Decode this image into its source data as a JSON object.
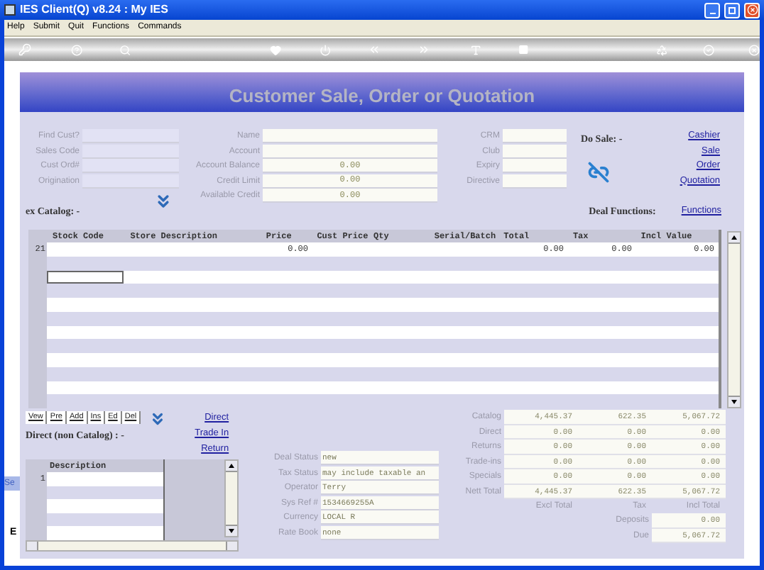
{
  "window": {
    "title": "IES Client(Q) v8.24 : My IES"
  },
  "menu": [
    {
      "label": "Help"
    },
    {
      "label": "Submit"
    },
    {
      "label": "Quit"
    },
    {
      "label": "Functions"
    },
    {
      "label": "Commands"
    }
  ],
  "header": {
    "title": "Customer Sale, Order or Quotation"
  },
  "customer_fields": [
    {
      "label": "Find Cust?"
    },
    {
      "label": "Sales Code"
    },
    {
      "label": "Cust Ord#"
    },
    {
      "label": "Origination"
    }
  ],
  "account_fields": [
    {
      "label": "Name"
    },
    {
      "label": "Account"
    },
    {
      "label": "Account Balance",
      "value": "0.00"
    },
    {
      "label": "Credit Limit",
      "value": "0.00"
    },
    {
      "label": "Available Credit",
      "value": "0.00"
    }
  ],
  "crm_fields": [
    {
      "label": "CRM"
    },
    {
      "label": "Club"
    },
    {
      "label": "Expiry"
    },
    {
      "label": "Directive"
    }
  ],
  "do_sale": {
    "label": "Do Sale: -",
    "links": [
      "Cashier",
      "Sale",
      "Order",
      "Quotation"
    ]
  },
  "catalog_label": "ex Catalog: -",
  "deal_functions": {
    "label": "Deal Functions:",
    "link": "Functions"
  },
  "catalog_grid": {
    "columns": [
      "Stock Code",
      "Store Description",
      "Price",
      "Cust Price",
      "Qty",
      "Serial/Batch",
      "Total",
      "Tax",
      "Incl Value"
    ],
    "rows": [
      {
        "number": "21",
        "cells": [
          "",
          "",
          "0.00",
          "",
          "",
          "",
          "0.00",
          "0.00",
          "0.00"
        ],
        "focused": false
      },
      {
        "focused": false
      },
      {
        "focused": true
      },
      {
        "focused": false
      },
      {
        "focused": false
      },
      {
        "focused": false
      },
      {
        "focused": false
      },
      {
        "focused": false
      },
      {
        "focused": false
      },
      {
        "focused": false
      },
      {
        "focused": false
      },
      {
        "focused": false
      }
    ]
  },
  "record_buttons": [
    "Vew",
    "Pre",
    "Add",
    "Ins",
    "Ed",
    "Del"
  ],
  "line_links": [
    "Direct",
    "Trade In",
    "Return"
  ],
  "direct_label": "Direct (non Catalog) : -",
  "direct_grid": {
    "columns": [
      "Description"
    ],
    "rows": [
      {
        "number": "1"
      },
      {},
      {},
      {},
      {}
    ]
  },
  "status_fields": [
    {
      "label": "Deal Status",
      "value": "new"
    },
    {
      "label": "Tax Status",
      "value": "may include taxable an"
    },
    {
      "label": "Operator",
      "value": "Terry"
    },
    {
      "label": "Sys Ref #",
      "value": "1534669255A"
    },
    {
      "label": "Currency",
      "value": "LOCAL R"
    },
    {
      "label": "Rate Book",
      "value": "none"
    }
  ],
  "totals": {
    "rows": [
      {
        "label": "Catalog",
        "values": [
          "4,445.37",
          "622.35",
          "5,067.72"
        ]
      },
      {
        "label": "Direct",
        "values": [
          "0.00",
          "0.00",
          "0.00"
        ]
      },
      {
        "label": "Returns",
        "values": [
          "0.00",
          "0.00",
          "0.00"
        ]
      },
      {
        "label": "Trade-ins",
        "values": [
          "0.00",
          "0.00",
          "0.00"
        ]
      },
      {
        "label": "Specials",
        "values": [
          "0.00",
          "0.00",
          "0.00"
        ]
      },
      {
        "label": "Nett Total",
        "values": [
          "4,445.37",
          "622.35",
          "5,067.72"
        ]
      }
    ],
    "columns": [
      "Excl Total",
      "Tax",
      "Incl Total"
    ],
    "deposits": {
      "label": "Deposits",
      "value": "0.00"
    },
    "due": {
      "label": "Due",
      "value": "5,067.72"
    }
  },
  "side_tabs": [
    "Se",
    "E"
  ]
}
